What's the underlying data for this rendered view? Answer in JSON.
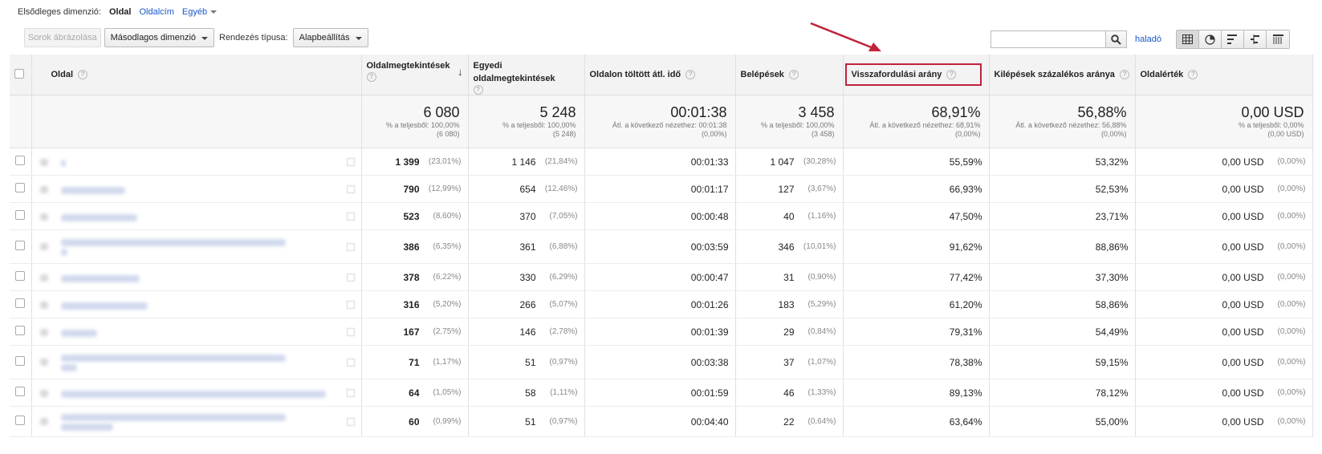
{
  "primary_dimension": {
    "label": "Elsődleges dimenzió:",
    "active": "Oldal",
    "options": [
      "Oldalcím",
      "Egyéb"
    ]
  },
  "toolbar": {
    "plot_rows": "Sorok ábrázolása",
    "secondary_dimension": "Másodlagos dimenzió",
    "sort_label": "Rendezés típusa:",
    "sort_value": "Alapbeállítás",
    "search_placeholder": "",
    "advanced": "haladó"
  },
  "view_icons": [
    "table-view-icon",
    "pie-view-icon",
    "performance-view-icon",
    "comparison-view-icon",
    "pivot-view-icon"
  ],
  "columns": [
    "Oldal",
    "Oldalmegtekintések",
    "Egyedi oldalmegtekintések",
    "Oldalon töltött átl. idő",
    "Belépések",
    "Visszafordulási arány",
    "Kilépések százalékos aránya",
    "Oldalérték"
  ],
  "totals": [
    {
      "big": "6 080",
      "sub1": "% a teljesből: 100,00%",
      "sub2": "(6 080)"
    },
    {
      "big": "5 248",
      "sub1": "% a teljesből: 100,00%",
      "sub2": "(5 248)"
    },
    {
      "big": "00:01:38",
      "sub1": "Átl. a következő nézethez: 00:01:38",
      "sub2": "(0,00%)"
    },
    {
      "big": "3 458",
      "sub1": "% a teljesből: 100,00%",
      "sub2": "(3 458)"
    },
    {
      "big": "68,91%",
      "sub1": "Átl. a következő nézethez: 68,91%",
      "sub2": "(0,00%)"
    },
    {
      "big": "56,88%",
      "sub1": "Átl. a következő nézethez: 56,88%",
      "sub2": "(0,00%)"
    },
    {
      "big": "0,00 USD",
      "sub1": "% a teljesből: 0,00%",
      "sub2": "(0,00 USD)"
    }
  ],
  "rows": [
    {
      "pv": "1 399",
      "pv_pct": "(23,01%)",
      "upv": "1 146",
      "upv_pct": "(21,84%)",
      "time": "00:01:33",
      "ent": "1 047",
      "ent_pct": "(30,28%)",
      "bounce": "55,59%",
      "exit": "53,32%",
      "val": "0,00 USD",
      "val_pct": "(0,00%)"
    },
    {
      "pv": "790",
      "pv_pct": "(12,99%)",
      "upv": "654",
      "upv_pct": "(12,46%)",
      "time": "00:01:17",
      "ent": "127",
      "ent_pct": "(3,67%)",
      "bounce": "66,93%",
      "exit": "52,53%",
      "val": "0,00 USD",
      "val_pct": "(0,00%)"
    },
    {
      "pv": "523",
      "pv_pct": "(8,60%)",
      "upv": "370",
      "upv_pct": "(7,05%)",
      "time": "00:00:48",
      "ent": "40",
      "ent_pct": "(1,16%)",
      "bounce": "47,50%",
      "exit": "23,71%",
      "val": "0,00 USD",
      "val_pct": "(0,00%)"
    },
    {
      "pv": "386",
      "pv_pct": "(6,35%)",
      "upv": "361",
      "upv_pct": "(6,88%)",
      "time": "00:03:59",
      "ent": "346",
      "ent_pct": "(10,01%)",
      "bounce": "91,62%",
      "exit": "88,86%",
      "val": "0,00 USD",
      "val_pct": "(0,00%)"
    },
    {
      "pv": "378",
      "pv_pct": "(6,22%)",
      "upv": "330",
      "upv_pct": "(6,29%)",
      "time": "00:00:47",
      "ent": "31",
      "ent_pct": "(0,90%)",
      "bounce": "77,42%",
      "exit": "37,30%",
      "val": "0,00 USD",
      "val_pct": "(0,00%)"
    },
    {
      "pv": "316",
      "pv_pct": "(5,20%)",
      "upv": "266",
      "upv_pct": "(5,07%)",
      "time": "00:01:26",
      "ent": "183",
      "ent_pct": "(5,29%)",
      "bounce": "61,20%",
      "exit": "58,86%",
      "val": "0,00 USD",
      "val_pct": "(0,00%)"
    },
    {
      "pv": "167",
      "pv_pct": "(2,75%)",
      "upv": "146",
      "upv_pct": "(2,78%)",
      "time": "00:01:39",
      "ent": "29",
      "ent_pct": "(0,84%)",
      "bounce": "79,31%",
      "exit": "54,49%",
      "val": "0,00 USD",
      "val_pct": "(0,00%)"
    },
    {
      "pv": "71",
      "pv_pct": "(1,17%)",
      "upv": "51",
      "upv_pct": "(0,97%)",
      "time": "00:03:38",
      "ent": "37",
      "ent_pct": "(1,07%)",
      "bounce": "78,38%",
      "exit": "59,15%",
      "val": "0,00 USD",
      "val_pct": "(0,00%)"
    },
    {
      "pv": "64",
      "pv_pct": "(1,05%)",
      "upv": "58",
      "upv_pct": "(1,11%)",
      "time": "00:01:59",
      "ent": "46",
      "ent_pct": "(1,33%)",
      "bounce": "89,13%",
      "exit": "78,12%",
      "val": "0,00 USD",
      "val_pct": "(0,00%)"
    },
    {
      "pv": "60",
      "pv_pct": "(0,99%)",
      "upv": "51",
      "upv_pct": "(0,97%)",
      "time": "00:04:40",
      "ent": "22",
      "ent_pct": "(0,64%)",
      "bounce": "63,64%",
      "exit": "55,00%",
      "val": "0,00 USD",
      "val_pct": "(0,00%)"
    }
  ],
  "colors": {
    "link": "#1a57c9",
    "highlight": "#c0223b",
    "header_bg": "#f3f3f3"
  }
}
